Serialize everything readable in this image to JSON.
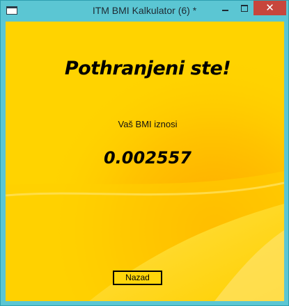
{
  "window": {
    "title": "ITM BMI Kalkulator (6) *",
    "close_glyph": "✕"
  },
  "main": {
    "headline": "Pothranjeni ste!",
    "bmi_label": "Vaš BMI iznosi",
    "bmi_value": "0.002557",
    "back_button_label": "Nazad"
  },
  "colors": {
    "window_frame": "#5bc6d3",
    "close_button": "#c7463c",
    "background_yellow": "#ffd100",
    "background_orange": "#ffa600"
  },
  "icons": [
    "app-icon",
    "minimize-icon",
    "maximize-icon",
    "close-icon"
  ]
}
